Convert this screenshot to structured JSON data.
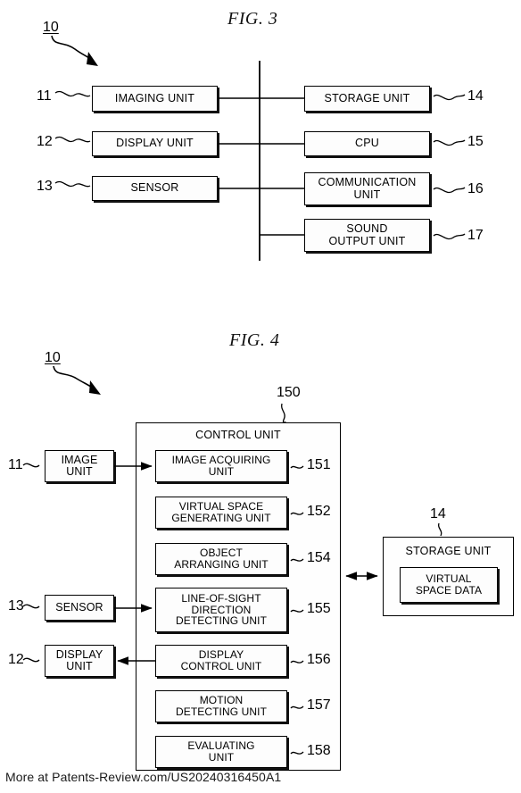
{
  "page": {
    "watermark": "More at Patents-Review.com/US20240316450A1"
  },
  "figures": [
    {
      "id": "fig3",
      "title": "FIG. 3",
      "system_ref": "10",
      "left_blocks": [
        {
          "ref": "11",
          "label": "IMAGING UNIT"
        },
        {
          "ref": "12",
          "label": "DISPLAY UNIT"
        },
        {
          "ref": "13",
          "label": "SENSOR"
        }
      ],
      "right_blocks": [
        {
          "ref": "14",
          "label": "STORAGE UNIT"
        },
        {
          "ref": "15",
          "label": "CPU"
        },
        {
          "ref": "16",
          "label": "COMMUNICATION\nUNIT"
        },
        {
          "ref": "17",
          "label": "SOUND\nOUTPUT UNIT"
        }
      ]
    },
    {
      "id": "fig4",
      "title": "FIG. 4",
      "system_ref": "10",
      "control_unit": {
        "ref": "150",
        "label": "CONTROL UNIT",
        "modules": [
          {
            "ref": "151",
            "label": "IMAGE ACQUIRING\nUNIT"
          },
          {
            "ref": "152",
            "label": "VIRTUAL SPACE\nGENERATING UNIT"
          },
          {
            "ref": "154",
            "label": "OBJECT\nARRANGING UNIT"
          },
          {
            "ref": "155",
            "label": "LINE-OF-SIGHT\nDIRECTION\nDETECTING UNIT"
          },
          {
            "ref": "156",
            "label": "DISPLAY\nCONTROL UNIT"
          },
          {
            "ref": "157",
            "label": "MOTION\nDETECTING UNIT"
          },
          {
            "ref": "158",
            "label": "EVALUATING\nUNIT"
          }
        ]
      },
      "peripherals": [
        {
          "ref": "11",
          "label": "IMAGE\nUNIT"
        },
        {
          "ref": "13",
          "label": "SENSOR"
        },
        {
          "ref": "12",
          "label": "DISPLAY\nUNIT"
        }
      ],
      "storage": {
        "ref": "14",
        "label": "STORAGE UNIT",
        "inner_label": "VIRTUAL\nSPACE DATA"
      }
    }
  ]
}
